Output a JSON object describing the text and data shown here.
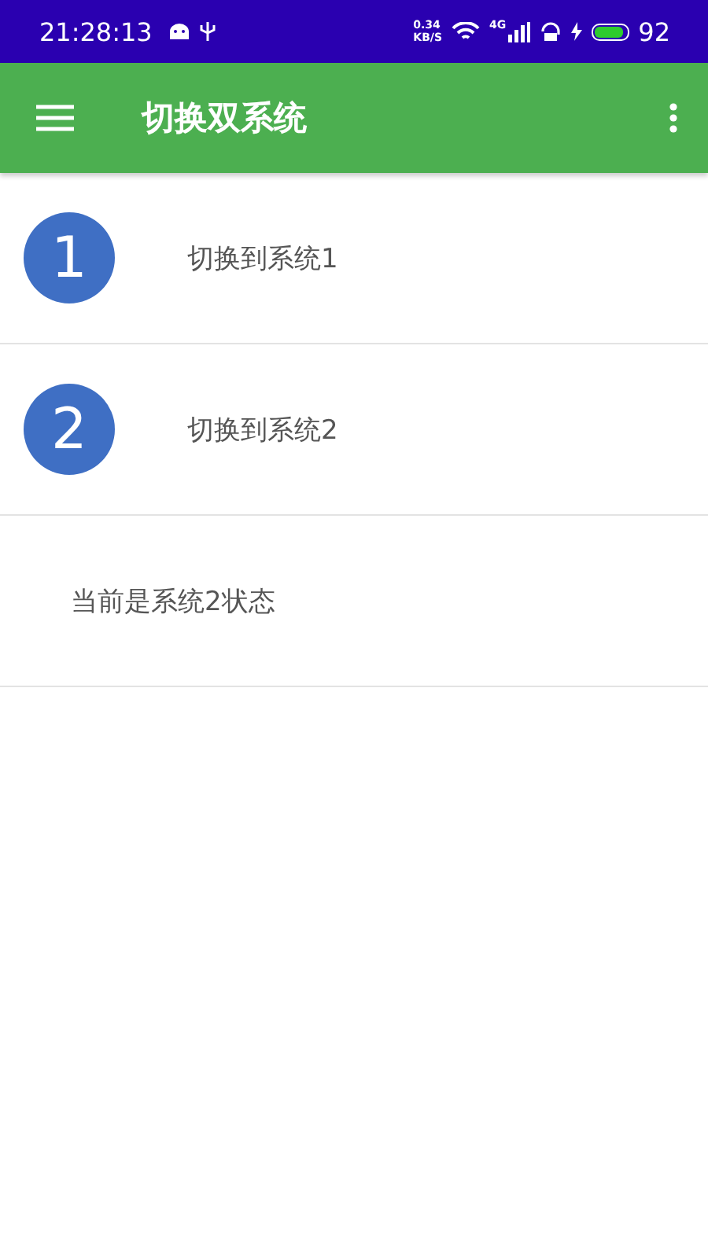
{
  "status_bar": {
    "time": "21:28:13",
    "net_speed": "0.34",
    "net_unit": "KB/S",
    "network": "4G",
    "battery": "92"
  },
  "app_bar": {
    "title": "切换双系统"
  },
  "items": [
    {
      "badge": "1",
      "label": "切换到系统1"
    },
    {
      "badge": "2",
      "label": "切换到系统2"
    }
  ],
  "status_text": "当前是系统2状态"
}
